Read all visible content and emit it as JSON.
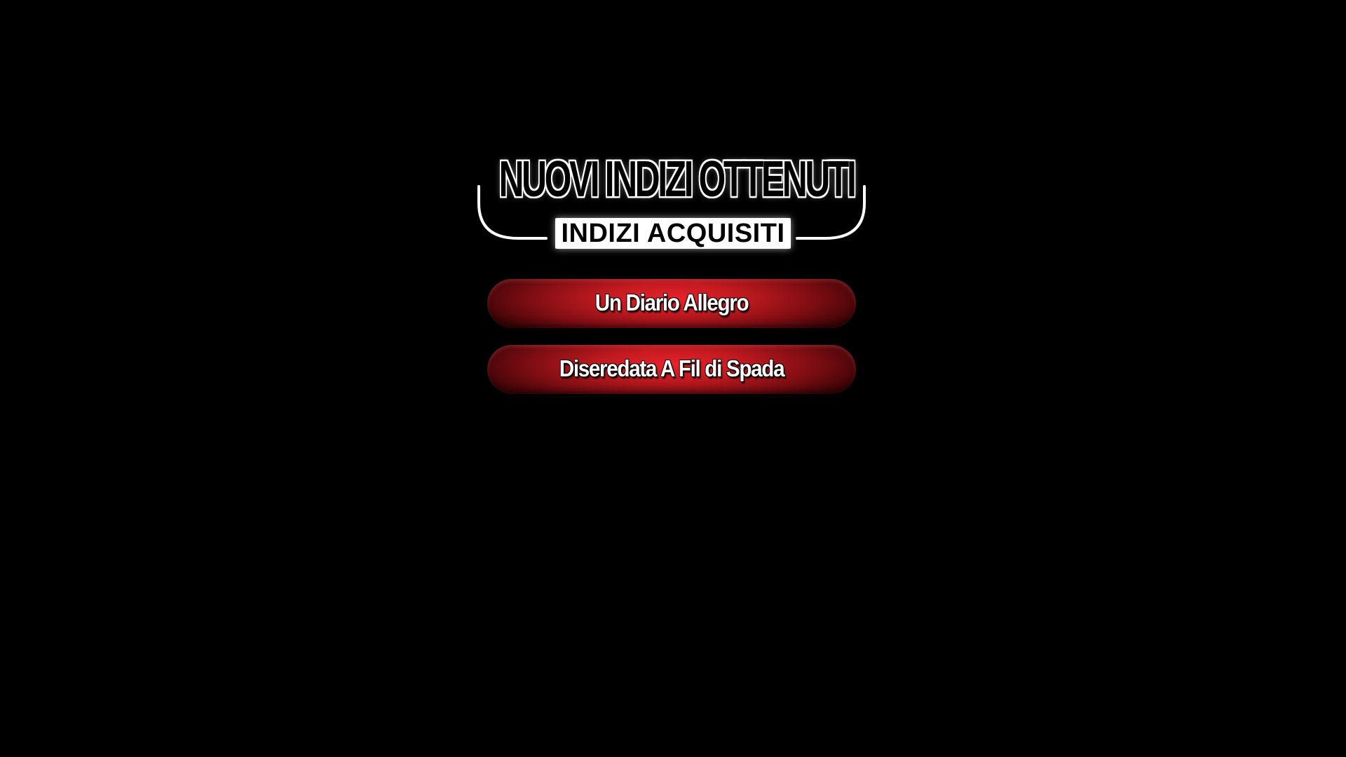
{
  "header": {
    "title": "NUOVI INDIZI OTTENUTI",
    "subtitle": "INDIZI ACQUISITI"
  },
  "clues": [
    {
      "label": "Un Diario Allegro"
    },
    {
      "label": "Diseredata A Fil di Spada"
    }
  ],
  "colors": {
    "background": "#000000",
    "button_red": "#e8232a",
    "button_dark": "#3a0406",
    "outline": "#ffffff"
  }
}
